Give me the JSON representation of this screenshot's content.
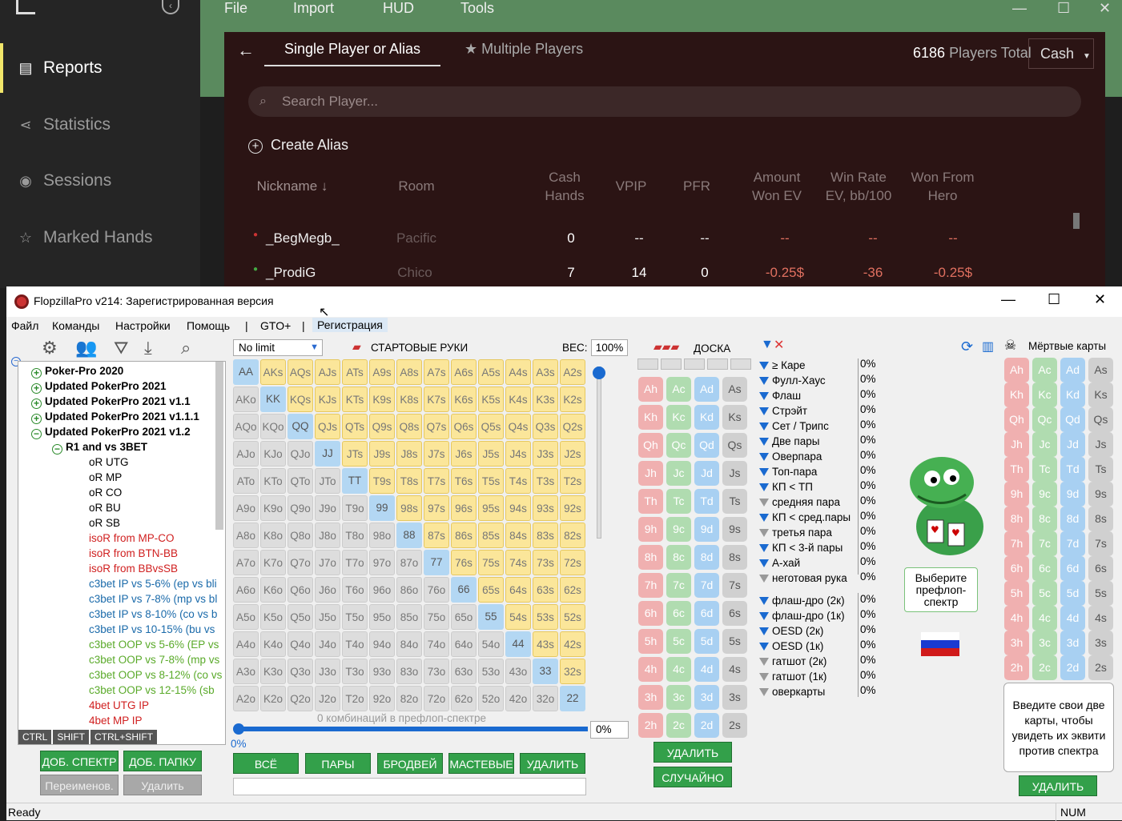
{
  "sidebar": {
    "items": [
      {
        "label": "Reports"
      },
      {
        "label": "Statistics"
      },
      {
        "label": "Sessions"
      },
      {
        "label": "Marked Hands"
      }
    ]
  },
  "menu": {
    "file": "File",
    "import": "Import",
    "hud": "HUD",
    "tools": "Tools"
  },
  "panel": {
    "tab_single": "Single Player or Alias",
    "tab_multi": "Multiple Players",
    "total_count": "6186",
    "total_label": "Players Total",
    "game_type": "Cash",
    "search_placeholder": "Search Player...",
    "create_alias": "Create Alias",
    "headers": {
      "nickname": "Nickname ↓",
      "room": "Room",
      "cash_hands_1": "Cash",
      "cash_hands_2": "Hands",
      "vpip": "VPIP",
      "pfr": "PFR",
      "amount_1": "Amount",
      "amount_2": "Won EV",
      "winrate_1": "Win Rate",
      "winrate_2": "EV, bb/100",
      "wonfrom_1": "Won From",
      "wonfrom_2": "Hero"
    },
    "rows": [
      {
        "nick": "_BegMegb_",
        "room": "Pacific",
        "hands": "0",
        "vpip": "--",
        "pfr": "--",
        "amount": "--",
        "winrate": "--",
        "wonfrom": "--"
      },
      {
        "nick": "_ProdiG",
        "room": "Chico",
        "hands": "7",
        "vpip": "14",
        "pfr": "0",
        "amount": "-0.25$",
        "winrate": "-36",
        "wonfrom": "-0.25$"
      }
    ]
  },
  "fz": {
    "title": "FlopzillaPro v214: Зарегистрированная версия",
    "menu": [
      "Файл",
      "Команды",
      "Настройки",
      "Помощь",
      "|",
      "GTO+",
      "|",
      "Регистрация"
    ],
    "tree": [
      {
        "t": "Poker-Pro 2020",
        "c": "black",
        "b": true,
        "pm": "+",
        "lvl": 0
      },
      {
        "t": "Updated PokerPro 2021",
        "c": "black",
        "b": true,
        "pm": "+",
        "lvl": 0
      },
      {
        "t": "Updated PokerPro 2021 v1.1",
        "c": "black",
        "b": true,
        "pm": "+",
        "lvl": 0
      },
      {
        "t": "Updated PokerPro 2021 v1.1.1",
        "c": "black",
        "b": true,
        "pm": "+",
        "lvl": 0
      },
      {
        "t": "Updated PokerPro 2021 v1.2",
        "c": "black",
        "b": true,
        "pm": "−",
        "lvl": 0
      },
      {
        "t": "R1 and vs 3BET",
        "c": "black",
        "b": true,
        "pm": "−",
        "lvl": 1
      },
      {
        "t": "oR UTG",
        "c": "black",
        "lvl": 2
      },
      {
        "t": "oR MP",
        "c": "black",
        "lvl": 2
      },
      {
        "t": "oR CO",
        "c": "black",
        "lvl": 2
      },
      {
        "t": "oR BU",
        "c": "black",
        "lvl": 2
      },
      {
        "t": "oR SB",
        "c": "black",
        "lvl": 2
      },
      {
        "t": "isoR from MP-CO",
        "c": "red",
        "lvl": 2
      },
      {
        "t": "isoR from BTN-BB",
        "c": "red",
        "lvl": 2
      },
      {
        "t": "isoR from BBvsSB",
        "c": "red",
        "lvl": 2
      },
      {
        "t": "c3bet IP vs 5-6% (ep vs bli",
        "c": "blue",
        "lvl": 2
      },
      {
        "t": "c3bet IP vs 7-8% (mp vs bl",
        "c": "blue",
        "lvl": 2
      },
      {
        "t": "c3bet IP vs 8-10% (co vs b",
        "c": "blue",
        "lvl": 2
      },
      {
        "t": "c3bet IP vs 10-15% (bu vs",
        "c": "blue",
        "lvl": 2
      },
      {
        "t": "c3bet OOP vs 5-6% (EP vs",
        "c": "green",
        "lvl": 2
      },
      {
        "t": "c3bet OOP vs 7-8% (mp vs",
        "c": "green",
        "lvl": 2
      },
      {
        "t": "c3bet OOP vs 8-12% (co vs",
        "c": "green",
        "lvl": 2
      },
      {
        "t": "c3bet OOP vs 12-15% (sb",
        "c": "green",
        "lvl": 2
      },
      {
        "t": "4bet UTG IP",
        "c": "red",
        "lvl": 2
      },
      {
        "t": "4bet MP IP",
        "c": "red",
        "lvl": 2
      }
    ],
    "keys": [
      "CTRL",
      "SHIFT",
      "CTRL+SHIFT"
    ],
    "btn_add_range": "ДОБ. СПЕКТР",
    "btn_add_folder": "ДОБ. ПАПКУ",
    "btn_rename": "Переименов.",
    "btn_delete": "Удалить",
    "limit": "No limit",
    "start_hands": "СТАРТОВЫЕ РУКИ",
    "weight_label": "ВЕС:",
    "weight": "100%",
    "combos": "0 комбинаций в префлоп-спектре",
    "combo_pct": "0%",
    "slider_pct": "0%",
    "btn_all": "ВСЁ",
    "btn_pairs": "ПАРЫ",
    "btn_broadway": "БРОДВЕЙ",
    "btn_suited": "МАСТЕВЫЕ",
    "btn_remove": "УДАЛИТЬ",
    "board_label": "ДОСКА",
    "btn_board_remove": "УДАЛИТЬ",
    "btn_random": "СЛУЧАЙНО",
    "dead_label": "Мёртвые карты",
    "btn_dead_remove": "УДАЛИТЬ",
    "select_range": "Выберите префлоп-спектр",
    "hint": "Введите свои две карты, чтобы увидеть их эквити против спектра",
    "stats1": [
      {
        "l": "≥ Каре",
        "p": "0%",
        "f": "b"
      },
      {
        "l": "Фулл-Хаус",
        "p": "0%",
        "f": "b"
      },
      {
        "l": "Флаш",
        "p": "0%",
        "f": "b"
      },
      {
        "l": "Стрэйт",
        "p": "0%",
        "f": "b"
      },
      {
        "l": "Сет / Трипс",
        "p": "0%",
        "f": "b"
      },
      {
        "l": "Две пары",
        "p": "0%",
        "f": "b"
      },
      {
        "l": "Оверпара",
        "p": "0%",
        "f": "b"
      },
      {
        "l": "Топ-пара",
        "p": "0%",
        "f": "b"
      },
      {
        "l": "КП < ТП",
        "p": "0%",
        "f": "b"
      },
      {
        "l": "средняя пара",
        "p": "0%",
        "f": "g"
      },
      {
        "l": "КП < сред.пары",
        "p": "0%",
        "f": "b"
      },
      {
        "l": "третья пара",
        "p": "0%",
        "f": "g"
      },
      {
        "l": "КП < 3-й пары",
        "p": "0%",
        "f": "b"
      },
      {
        "l": "А-хай",
        "p": "0%",
        "f": "b"
      },
      {
        "l": "неготовая рука",
        "p": "0%",
        "f": "g"
      }
    ],
    "stats2": [
      {
        "l": "флаш-дро (2к)",
        "p": "0%",
        "f": "b"
      },
      {
        "l": "флаш-дро (1к)",
        "p": "0%",
        "f": "b"
      },
      {
        "l": "OESD (2к)",
        "p": "0%",
        "f": "b"
      },
      {
        "l": "OESD (1к)",
        "p": "0%",
        "f": "b"
      },
      {
        "l": "гатшот (2к)",
        "p": "0%",
        "f": "g"
      },
      {
        "l": "гатшот (1к)",
        "p": "0%",
        "f": "g"
      },
      {
        "l": "оверкарты",
        "p": "0%",
        "f": "g"
      }
    ],
    "status": "Ready",
    "num": "NUM"
  },
  "colors": {
    "accent_green": "#33a04a",
    "reports_bar": "#f1e66a",
    "panel_bg": "#2b1414",
    "negative": "#e07060"
  }
}
